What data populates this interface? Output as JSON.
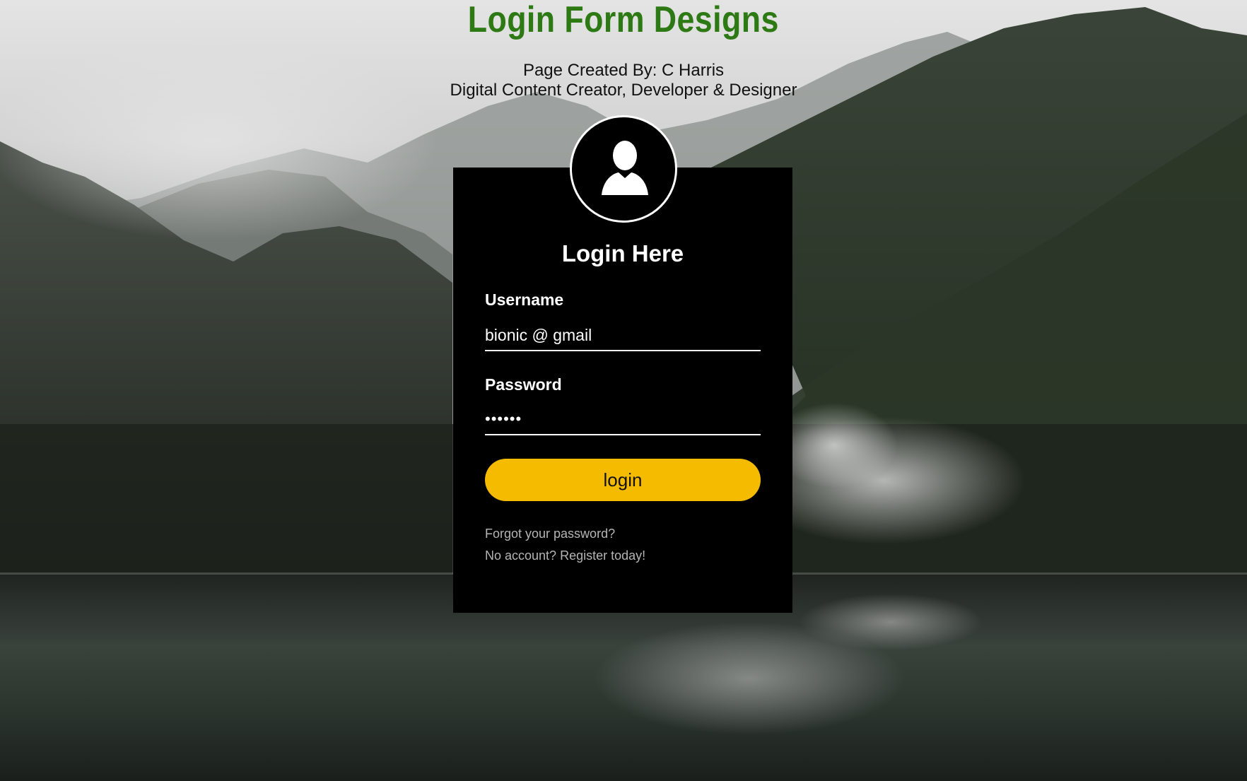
{
  "header": {
    "title": "Login Form Designs",
    "credit_line1": "Page Created By: C Harris",
    "credit_line2": "Digital Content Creator, Developer & Designer"
  },
  "login_box": {
    "avatar_icon": "user-silhouette-icon",
    "title": "Login Here",
    "username_label": "Username",
    "username_value": "bionic @ gmail",
    "password_label": "Password",
    "password_value": "••••••",
    "login_button": "login",
    "forgot_link": "Forgot your password?",
    "register_link": "No account? Register today!"
  },
  "colors": {
    "title_green": "#2d7a14",
    "box_background": "#000000",
    "button_yellow": "#f5bb00",
    "link_gray": "#b5b5b5"
  }
}
